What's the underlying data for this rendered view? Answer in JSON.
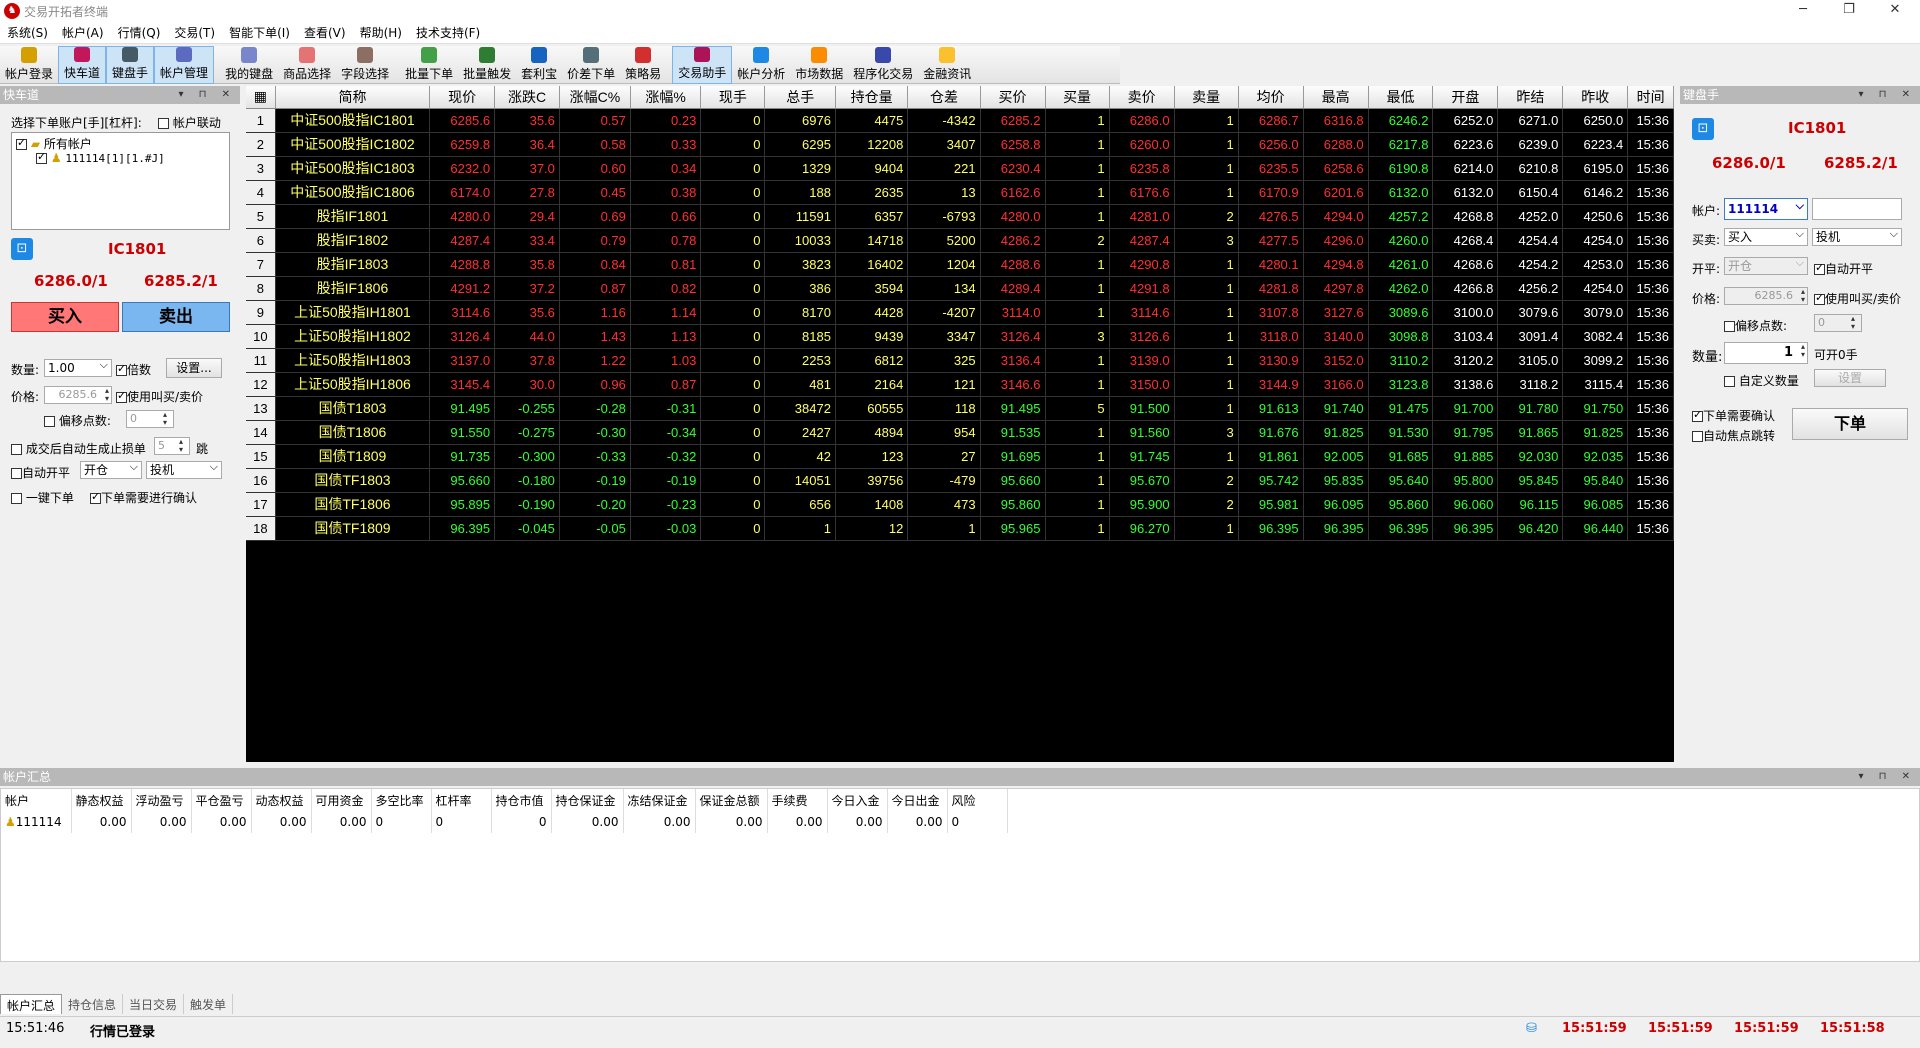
{
  "window": {
    "title": "交易开拓者终端",
    "min": "─",
    "max": "❐",
    "close": "✕"
  },
  "menu": [
    "系统(S)",
    "帐户(A)",
    "行情(Q)",
    "交易(T)",
    "智能下单(I)",
    "查看(V)",
    "帮助(H)",
    "技术支持(F)"
  ],
  "toolbar": [
    "帐户登录",
    "快车道",
    "键盘手",
    "帐户管理",
    "我的键盘",
    "商品选择",
    "字段选择",
    "批量下单",
    "批量触发",
    "套利宝",
    "价差下单",
    "策略易",
    "交易助手",
    "帐户分析",
    "市场数据",
    "程序化交易",
    "金融资讯"
  ],
  "left": {
    "header": "快车道",
    "select_label": "选择下单账户[手][杠杆]:",
    "link_label": "帐户联动",
    "tree_root": "所有帐户",
    "tree_child": "111114[1][1.#J]",
    "contract": "IC1801",
    "bid": "6286.0/1",
    "ask": "6285.2/1",
    "buy": "买入",
    "sell": "卖出",
    "qty_label": "数量:",
    "qty_value": "1.00",
    "multiple_label": "倍数",
    "settings": "设置...",
    "price_label": "价格:",
    "price_value": "6285.6",
    "use_bidask": "使用叫买/卖价",
    "offset_label": "偏移点数:",
    "offset_value": "0",
    "auto_stop_label": "成交后自动生成止损单",
    "auto_stop_value": "5",
    "auto_stop_unit": "跳",
    "auto_open_label": "自动开平",
    "open_value": "开仓",
    "hedge_value": "投机",
    "onekey_label": "一键下单",
    "confirm_label": "下单需要进行确认"
  },
  "grid": {
    "columns": [
      "简称",
      "现价",
      "涨跌C",
      "涨幅C%",
      "涨幅%",
      "现手",
      "总手",
      "持仓量",
      "仓差",
      "买价",
      "买量",
      "卖价",
      "卖量",
      "均价",
      "最高",
      "最低",
      "开盘",
      "昨结",
      "昨收",
      "时间"
    ],
    "rows": [
      {
        "n": "1",
        "name": "中证500股指IC1801",
        "c": "r",
        "v": [
          "6285.6",
          "35.6",
          "0.57",
          "0.23",
          "0",
          "6976",
          "4475",
          "-4342",
          "6285.2",
          "1",
          "6286.0",
          "1",
          "6286.7",
          "6316.8",
          "6246.2",
          "6252.0",
          "6271.0",
          "6250.0",
          "15:36"
        ]
      },
      {
        "n": "2",
        "name": "中证500股指IC1802",
        "c": "r",
        "v": [
          "6259.8",
          "36.4",
          "0.58",
          "0.33",
          "0",
          "6295",
          "12208",
          "3407",
          "6258.8",
          "1",
          "6260.0",
          "1",
          "6256.0",
          "6288.0",
          "6217.8",
          "6223.6",
          "6239.0",
          "6223.4",
          "15:36"
        ]
      },
      {
        "n": "3",
        "name": "中证500股指IC1803",
        "c": "r",
        "v": [
          "6232.0",
          "37.0",
          "0.60",
          "0.34",
          "0",
          "1329",
          "9404",
          "221",
          "6230.4",
          "1",
          "6235.8",
          "1",
          "6235.5",
          "6258.6",
          "6190.8",
          "6214.0",
          "6210.8",
          "6195.0",
          "15:36"
        ]
      },
      {
        "n": "4",
        "name": "中证500股指IC1806",
        "c": "r",
        "v": [
          "6174.0",
          "27.8",
          "0.45",
          "0.38",
          "0",
          "188",
          "2635",
          "13",
          "6162.6",
          "1",
          "6176.6",
          "1",
          "6170.9",
          "6201.6",
          "6132.0",
          "6132.0",
          "6150.4",
          "6146.2",
          "15:36"
        ]
      },
      {
        "n": "5",
        "name": "股指IF1801",
        "c": "r",
        "v": [
          "4280.0",
          "29.4",
          "0.69",
          "0.66",
          "0",
          "11591",
          "6357",
          "-6793",
          "4280.0",
          "1",
          "4281.0",
          "2",
          "4276.5",
          "4294.0",
          "4257.2",
          "4268.8",
          "4252.0",
          "4250.6",
          "15:36"
        ]
      },
      {
        "n": "6",
        "name": "股指IF1802",
        "c": "r",
        "v": [
          "4287.4",
          "33.4",
          "0.79",
          "0.78",
          "0",
          "10033",
          "14718",
          "5200",
          "4286.2",
          "2",
          "4287.4",
          "3",
          "4277.5",
          "4296.0",
          "4260.0",
          "4268.4",
          "4254.4",
          "4254.0",
          "15:36"
        ]
      },
      {
        "n": "7",
        "name": "股指IF1803",
        "c": "r",
        "v": [
          "4288.8",
          "35.8",
          "0.84",
          "0.81",
          "0",
          "3823",
          "16402",
          "1204",
          "4288.6",
          "1",
          "4290.8",
          "1",
          "4280.1",
          "4294.8",
          "4261.0",
          "4268.6",
          "4254.2",
          "4253.0",
          "15:36"
        ]
      },
      {
        "n": "8",
        "name": "股指IF1806",
        "c": "r",
        "v": [
          "4291.2",
          "37.2",
          "0.87",
          "0.82",
          "0",
          "386",
          "3594",
          "134",
          "4289.4",
          "1",
          "4291.8",
          "1",
          "4281.8",
          "4297.8",
          "4262.0",
          "4266.8",
          "4256.2",
          "4254.0",
          "15:36"
        ]
      },
      {
        "n": "9",
        "name": "上证50股指IH1801",
        "c": "r",
        "v": [
          "3114.6",
          "35.6",
          "1.16",
          "1.14",
          "0",
          "8170",
          "4428",
          "-4207",
          "3114.0",
          "1",
          "3114.6",
          "1",
          "3107.8",
          "3127.6",
          "3089.6",
          "3100.0",
          "3079.6",
          "3079.0",
          "15:36"
        ]
      },
      {
        "n": "10",
        "name": "上证50股指IH1802",
        "c": "r",
        "v": [
          "3126.4",
          "44.0",
          "1.43",
          "1.13",
          "0",
          "8185",
          "9439",
          "3347",
          "3126.4",
          "3",
          "3126.6",
          "1",
          "3118.0",
          "3140.0",
          "3098.8",
          "3103.4",
          "3091.4",
          "3082.4",
          "15:36"
        ]
      },
      {
        "n": "11",
        "name": "上证50股指IH1803",
        "c": "r",
        "v": [
          "3137.0",
          "37.8",
          "1.22",
          "1.03",
          "0",
          "2253",
          "6812",
          "325",
          "3136.4",
          "1",
          "3139.0",
          "1",
          "3130.9",
          "3152.0",
          "3110.2",
          "3120.2",
          "3105.0",
          "3099.2",
          "15:36"
        ]
      },
      {
        "n": "12",
        "name": "上证50股指IH1806",
        "c": "r",
        "v": [
          "3145.4",
          "30.0",
          "0.96",
          "0.87",
          "0",
          "481",
          "2164",
          "121",
          "3146.6",
          "1",
          "3150.0",
          "1",
          "3144.9",
          "3166.0",
          "3123.8",
          "3138.6",
          "3118.2",
          "3115.4",
          "15:36"
        ]
      },
      {
        "n": "13",
        "name": "国债T1803",
        "c": "g",
        "v": [
          "91.495",
          "-0.255",
          "-0.28",
          "-0.31",
          "0",
          "38472",
          "60555",
          "118",
          "91.495",
          "5",
          "91.500",
          "1",
          "91.613",
          "91.740",
          "91.475",
          "91.700",
          "91.780",
          "91.750",
          "15:36"
        ]
      },
      {
        "n": "14",
        "name": "国债T1806",
        "c": "g",
        "v": [
          "91.550",
          "-0.275",
          "-0.30",
          "-0.34",
          "0",
          "2427",
          "4894",
          "954",
          "91.535",
          "1",
          "91.560",
          "3",
          "91.676",
          "91.825",
          "91.530",
          "91.795",
          "91.865",
          "91.825",
          "15:36"
        ]
      },
      {
        "n": "15",
        "name": "国债T1809",
        "c": "g",
        "v": [
          "91.735",
          "-0.300",
          "-0.33",
          "-0.32",
          "0",
          "42",
          "123",
          "27",
          "91.695",
          "1",
          "91.745",
          "1",
          "91.861",
          "92.005",
          "91.685",
          "91.885",
          "92.030",
          "92.035",
          "15:36"
        ]
      },
      {
        "n": "16",
        "name": "国债TF1803",
        "c": "g",
        "v": [
          "95.660",
          "-0.180",
          "-0.19",
          "-0.19",
          "0",
          "14051",
          "39756",
          "-479",
          "95.660",
          "1",
          "95.670",
          "2",
          "95.742",
          "95.835",
          "95.640",
          "95.800",
          "95.845",
          "95.840",
          "15:36"
        ]
      },
      {
        "n": "17",
        "name": "国债TF1806",
        "c": "g",
        "v": [
          "95.895",
          "-0.190",
          "-0.20",
          "-0.23",
          "0",
          "656",
          "1408",
          "473",
          "95.860",
          "1",
          "95.900",
          "2",
          "95.981",
          "96.095",
          "95.860",
          "96.060",
          "96.115",
          "96.085",
          "15:36"
        ]
      },
      {
        "n": "18",
        "name": "国债TF1809",
        "c": "g",
        "v": [
          "96.395",
          "-0.045",
          "-0.05",
          "-0.03",
          "0",
          "1",
          "12",
          "1",
          "95.965",
          "1",
          "96.270",
          "1",
          "96.395",
          "96.395",
          "96.395",
          "96.395",
          "96.420",
          "96.440",
          "15:36"
        ]
      }
    ]
  },
  "right": {
    "header": "键盘手",
    "contract": "IC1801",
    "bid": "6286.0/1",
    "ask": "6285.2/1",
    "account_label": "帐户:",
    "account_value": "111114",
    "side_label": "买卖:",
    "side_value": "买入",
    "hedge_value": "投机",
    "openclose_label": "开平:",
    "openclose_value": "开仓",
    "auto_open": "自动开平",
    "price_label": "价格:",
    "price_value": "6285.6",
    "use_bidask": "使用叫买/卖价",
    "offset_label": "偏移点数:",
    "offset_value": "0",
    "qty_label": "数量:",
    "qty_value": "1",
    "can_open": "可开0手",
    "custom_qty": "自定义数量",
    "set": "设置",
    "need_confirm": "下单需要确认",
    "auto_focus": "自动焦点跳转",
    "order": "下单"
  },
  "account": {
    "header": "帐户汇总",
    "columns": [
      "帐户",
      "静态权益",
      "浮动盈亏",
      "平仓盈亏",
      "动态权益",
      "可用资金",
      "多空比率",
      "杠杆率",
      "持仓市值",
      "持仓保证金",
      "冻结保证金",
      "保证金总额",
      "手续费",
      "今日入金",
      "今日出金",
      "风险"
    ],
    "row": [
      "111114",
      "0.00",
      "0.00",
      "0.00",
      "0.00",
      "0.00",
      "0",
      "0",
      "0",
      "0.00",
      "0.00",
      "0.00",
      "0.00",
      "0.00",
      "0.00",
      "0"
    ],
    "tabs": [
      "帐户汇总",
      "持仓信息",
      "当日交易",
      "触发单"
    ]
  },
  "status": {
    "time": "15:51:46",
    "login": "行情已登录",
    "clocks": [
      "15:51:59",
      "15:51:59",
      "15:51:59",
      "15:51:58"
    ]
  }
}
